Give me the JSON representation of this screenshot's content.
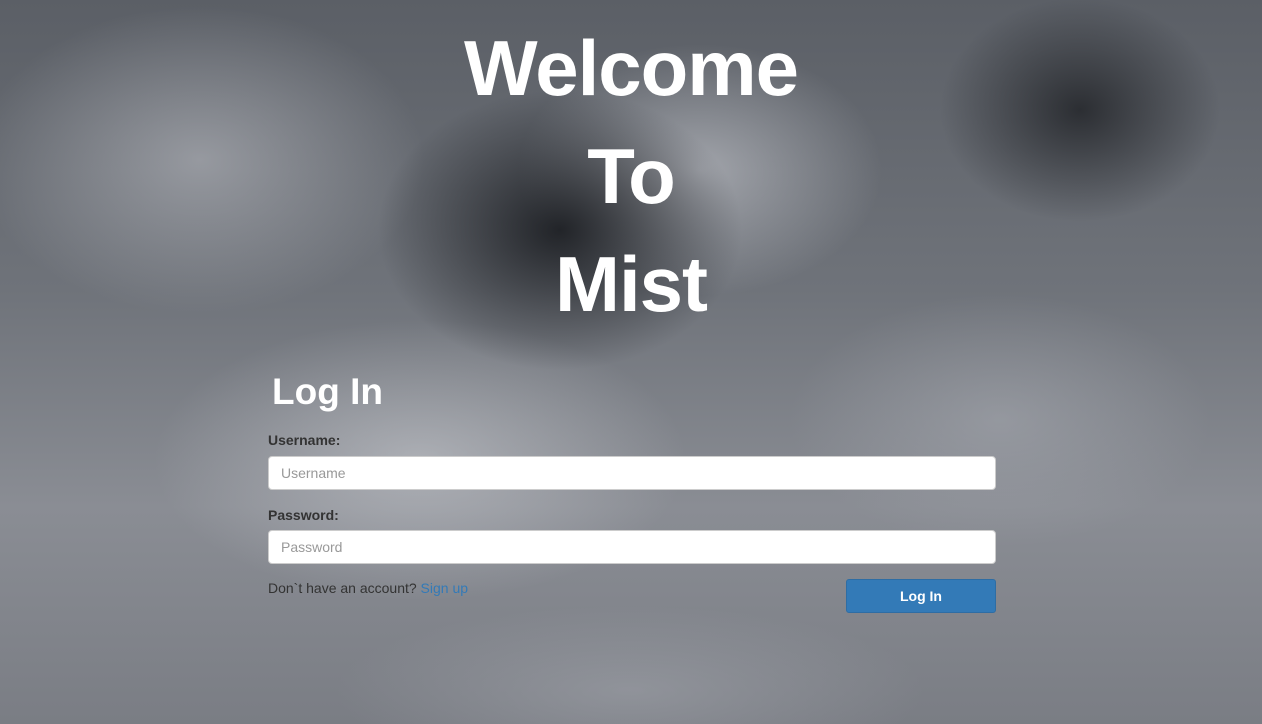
{
  "hero": {
    "line1": "Welcome",
    "line2": "To",
    "line3": "Mist"
  },
  "login": {
    "title": "Log In",
    "username_label": "Username:",
    "username_placeholder": "Username",
    "username_value": "",
    "password_label": "Password:",
    "password_placeholder": "Password",
    "password_value": "",
    "no_account_text": "Don`t have an account?",
    "signup_link": "Sign up",
    "submit_label": "Log In"
  },
  "colors": {
    "accent": "#337ab7",
    "heading": "#ffffff",
    "label": "#333333"
  }
}
